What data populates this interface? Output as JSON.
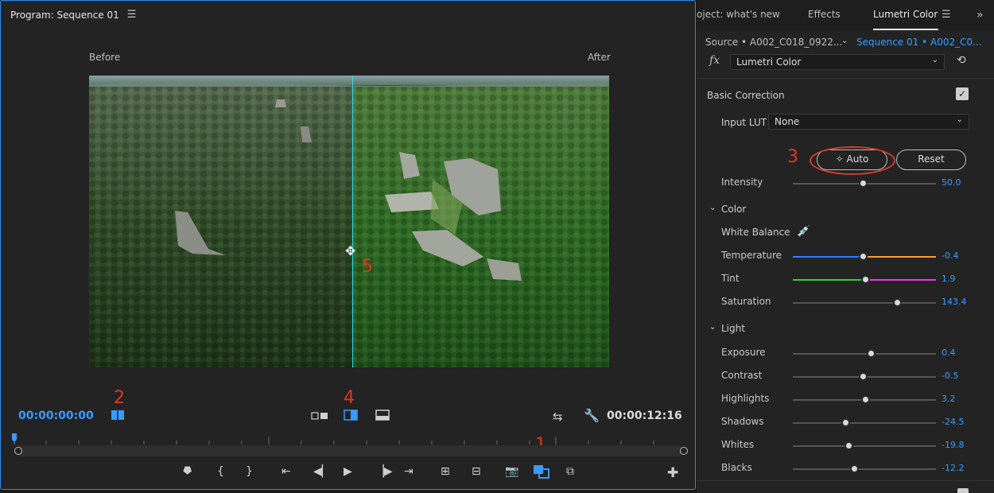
{
  "program": {
    "title": "Program: Sequence 01",
    "before_label": "Before",
    "after_label": "After",
    "timecode_current": "00:00:00:00",
    "timecode_duration": "00:00:12:16",
    "markers": [
      "1",
      "2",
      "3",
      "4",
      "5"
    ]
  },
  "panel": {
    "tabs": [
      "oject: what's new",
      "Effects",
      "Lumetri Color"
    ],
    "active_tab": "Lumetri Color",
    "source_label": "Source • A002_C018_0922...",
    "sequence_label": "Sequence 01 • A002_C0...",
    "effect_dropdown": "Lumetri Color",
    "basic_correction": "Basic Correction",
    "input_lut_label": "Input LUT",
    "input_lut_value": "None",
    "auto_label": "Auto",
    "reset_label": "Reset",
    "intensity_label": "Intensity",
    "intensity_value": "50.0",
    "color_section": "Color",
    "white_balance_label": "White Balance",
    "light_section": "Light"
  },
  "params": [
    {
      "key": "temperature",
      "name": "Temperature",
      "value": "-0.4",
      "pos": 0.5
    },
    {
      "key": "tint",
      "name": "Tint",
      "value": "1.9",
      "pos": 0.52
    },
    {
      "key": "saturation",
      "name": "Saturation",
      "value": "143.4",
      "pos": 0.74
    },
    {
      "key": "exposure",
      "name": "Exposure",
      "value": "0.4",
      "pos": 0.56
    },
    {
      "key": "contrast",
      "name": "Contrast",
      "value": "-0.5",
      "pos": 0.5
    },
    {
      "key": "highlights",
      "name": "Highlights",
      "value": "3.2",
      "pos": 0.52
    },
    {
      "key": "shadows",
      "name": "Shadows",
      "value": "-24.5",
      "pos": 0.38
    },
    {
      "key": "whites",
      "name": "Whites",
      "value": "-19.8",
      "pos": 0.4
    },
    {
      "key": "blacks",
      "name": "Blacks",
      "value": "-12.2",
      "pos": 0.44
    }
  ],
  "intensity_pos": 0.5,
  "colors": {
    "accent": "#3a9bff",
    "marker": "#e03620",
    "split_line": "#36d4e8"
  }
}
